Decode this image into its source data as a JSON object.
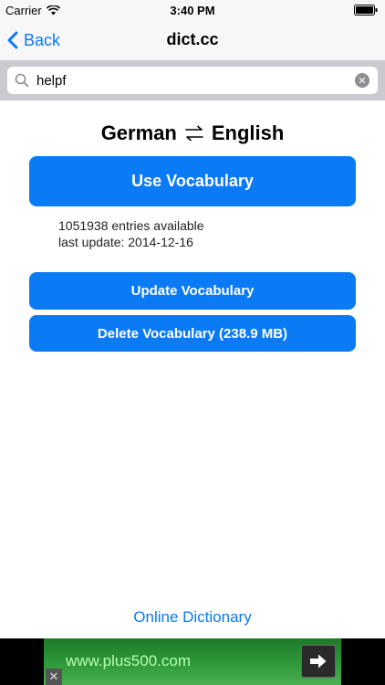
{
  "status_bar": {
    "carrier": "Carrier",
    "time": "3:40 PM"
  },
  "nav": {
    "back_label": "Back",
    "title": "dict.cc"
  },
  "search": {
    "value": "helpf"
  },
  "vocabulary": {
    "lang_from": "German",
    "lang_to": "English",
    "use_label": "Use Vocabulary",
    "entries": "1051938 entries available",
    "last_update": "last update: 2014-12-16",
    "update_label": "Update Vocabulary",
    "delete_label": "Delete Vocabulary (238.9 MB)"
  },
  "footer": {
    "online_link": "Online Dictionary"
  },
  "ad": {
    "text": "www.plus500.com"
  },
  "colors": {
    "accent": "#0a7af5",
    "bar_background": "#f7f7f7",
    "search_background": "#c9c9ce",
    "ad_green": "#2f9a3b"
  },
  "icons": {
    "wifi": "wifi-icon",
    "battery": "battery-icon",
    "back": "chevron-left-icon",
    "search": "search-icon",
    "clear": "clear-icon",
    "swap": "swap-arrows-icon",
    "ad_arrow": "arrow-right-icon",
    "ad_close": "close-icon"
  }
}
